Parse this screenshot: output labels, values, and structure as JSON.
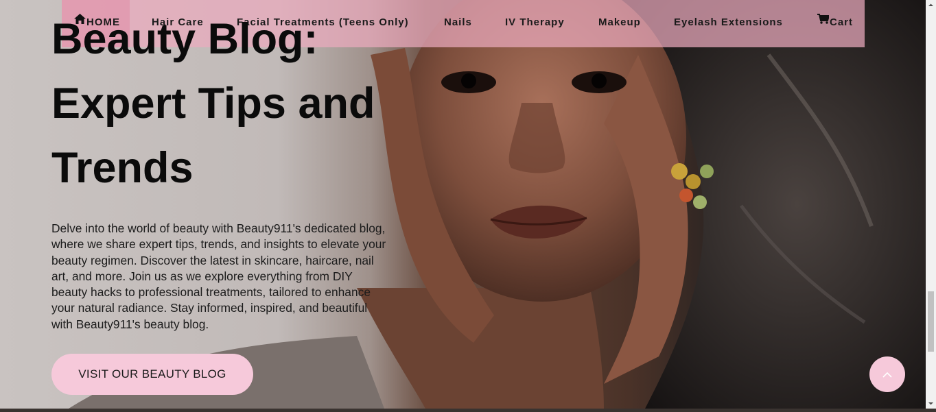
{
  "nav": {
    "items": [
      {
        "label": "HOME",
        "icon": "home-icon"
      },
      {
        "label": "Hair Care"
      },
      {
        "label": "Facial Treatments (Teens Only)"
      },
      {
        "label": "Nails"
      },
      {
        "label": "IV Therapy"
      },
      {
        "label": "Makeup"
      },
      {
        "label": "Eyelash Extensions"
      },
      {
        "label": "Cart",
        "icon": "cart-icon"
      }
    ]
  },
  "hero": {
    "headline_lines": [
      "Beauty Blog:",
      "Expert Tips and",
      "Trends"
    ],
    "intro": "Delve into the world of beauty with Beauty911's dedicated blog, where we share expert tips, trends, and insights to elevate your beauty regimen. Discover the latest in skincare, haircare, nail art, and more. Join us as we explore everything from DIY beauty hacks to professional treatments, tailored to enhance your natural radiance. Stay informed, inspired, and beautiful with Beauty911's beauty blog.",
    "cta_label": "VISIT OUR BEAUTY BLOG"
  },
  "back_to_top": {
    "icon": "chevron-up-icon"
  },
  "colors": {
    "nav_bg": "#ebaabe",
    "nav_active": "#e28ca5",
    "button_pink": "#f6c9da",
    "text_dark": "#0b0b0b"
  }
}
